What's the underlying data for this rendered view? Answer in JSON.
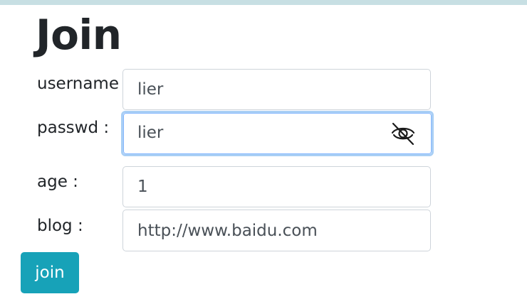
{
  "page": {
    "title": "Join"
  },
  "form": {
    "username": {
      "label": "username",
      "value": "lier"
    },
    "passwd": {
      "label": "passwd :",
      "value": "lier",
      "toggle_icon": "eye-slash-icon"
    },
    "age": {
      "label": "age :",
      "value": "1"
    },
    "blog": {
      "label": "blog :",
      "value": "http://www.baidu.com"
    },
    "submit_label": "join"
  },
  "colors": {
    "button_bg": "#17a2b8",
    "button_text": "#ffffff",
    "focus_ring": "#a9cff5",
    "input_border": "#ced4da",
    "top_strip": "#c7dfe3"
  }
}
